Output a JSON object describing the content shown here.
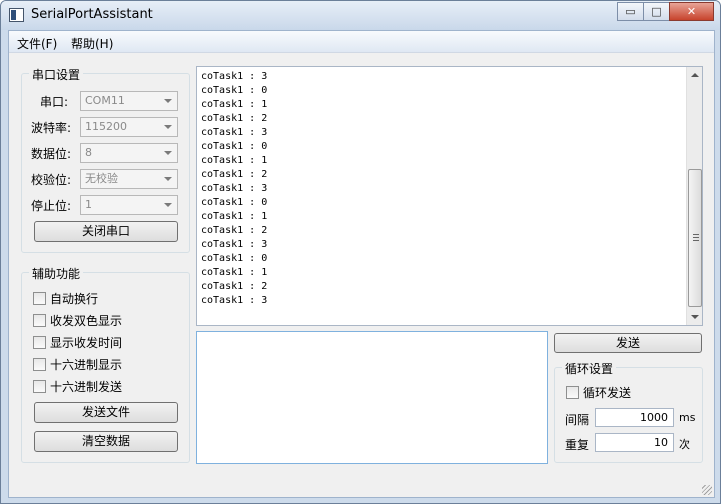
{
  "window": {
    "title": "SerialPortAssistant",
    "controls": {
      "minimize": "▭",
      "maximize": "□",
      "close": "✕"
    }
  },
  "menu": {
    "file": "文件(F)",
    "help": "帮助(H)"
  },
  "serial_settings": {
    "title": "串口设置",
    "port": {
      "label": "串口:",
      "value": "COM11"
    },
    "baud": {
      "label": "波特率:",
      "value": "115200"
    },
    "data_bits": {
      "label": "数据位:",
      "value": "8"
    },
    "parity": {
      "label": "校验位:",
      "value": "无校验"
    },
    "stop_bits": {
      "label": "停止位:",
      "value": "1"
    },
    "toggle_port_button": "关闭串口"
  },
  "aux": {
    "title": "辅助功能",
    "auto_newline": "自动换行",
    "dual_color": "收发双色显示",
    "show_time": "显示收发时间",
    "hex_display": "十六进制显示",
    "hex_send": "十六进制发送",
    "send_file_button": "发送文件",
    "clear_button": "清空数据"
  },
  "receive": {
    "lines": [
      "coTask1 : 3",
      "coTask1 : 0",
      "coTask1 : 1",
      "coTask1 : 2",
      "coTask1 : 3",
      "coTask1 : 0",
      "coTask1 : 1",
      "coTask1 : 2",
      "coTask1 : 3",
      "coTask1 : 0",
      "coTask1 : 1",
      "coTask1 : 2",
      "coTask1 : 3",
      "coTask1 : 0",
      "coTask1 : 1",
      "coTask1 : 2",
      "coTask1 : 3"
    ]
  },
  "send": {
    "text": "",
    "send_button": "发送"
  },
  "loop": {
    "title": "循环设置",
    "loop_send": "循环发送",
    "interval": {
      "label": "间隔",
      "value": "1000",
      "unit": "ms"
    },
    "repeat": {
      "label": "重复",
      "value": "10",
      "unit": "次"
    }
  }
}
